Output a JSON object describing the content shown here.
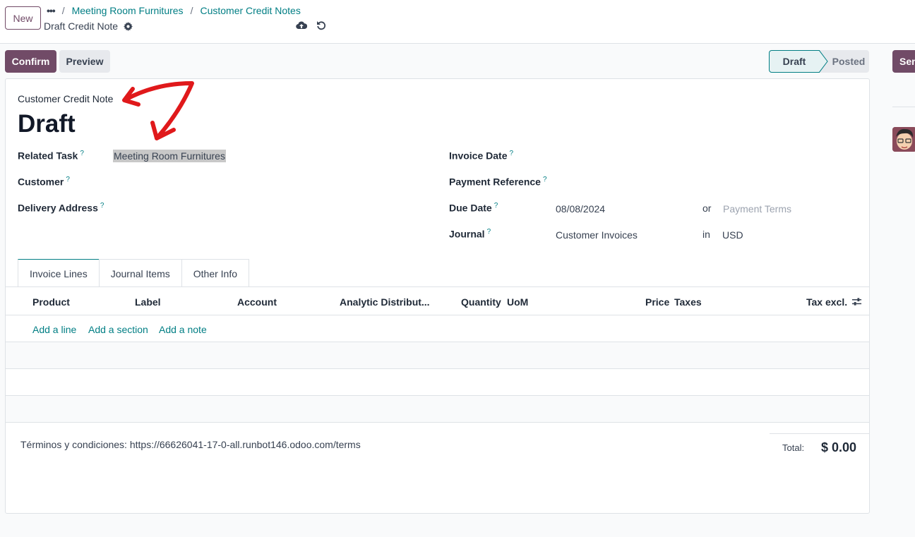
{
  "control_panel": {
    "new_label": "New",
    "breadcrumb": [
      "Meeting Room Furnitures",
      "Customer Credit Notes"
    ],
    "record_name": "Draft Credit Note"
  },
  "status_bar": {
    "confirm": "Confirm",
    "preview": "Preview",
    "send": "Sen",
    "stages": [
      "Draft",
      "Posted"
    ],
    "active_stage": "Draft"
  },
  "form": {
    "type_label": "Customer Credit Note",
    "title": "Draft",
    "left_fields": [
      {
        "label": "Related Task",
        "value": "Meeting Room Furnitures"
      },
      {
        "label": "Customer",
        "value": ""
      },
      {
        "label": "Delivery Address",
        "value": ""
      }
    ],
    "right_fields": {
      "invoice_date": {
        "label": "Invoice Date",
        "value": ""
      },
      "payment_reference": {
        "label": "Payment Reference",
        "value": ""
      },
      "due_date": {
        "label": "Due Date",
        "value": "08/08/2024",
        "or": "or",
        "payment_terms_placeholder": "Payment Terms"
      },
      "journal": {
        "label": "Journal",
        "value": "Customer Invoices",
        "in": "in",
        "currency": "USD"
      }
    }
  },
  "tabs": [
    "Invoice Lines",
    "Journal Items",
    "Other Info"
  ],
  "active_tab": "Invoice Lines",
  "table": {
    "columns": [
      "Product",
      "Label",
      "Account",
      "Analytic Distribut...",
      "Quantity",
      "UoM",
      "Price",
      "Taxes",
      "Tax excl."
    ],
    "actions": [
      "Add a line",
      "Add a section",
      "Add a note"
    ]
  },
  "footer": {
    "terms": "Términos y condiciones: https://66626041-17-0-all.runbot146.odoo.com/terms",
    "total_label": "Total:",
    "total_value": "$ 0.00"
  },
  "colors": {
    "brand": "#714b67",
    "link": "#017e84",
    "annotation": "#e0191b"
  }
}
